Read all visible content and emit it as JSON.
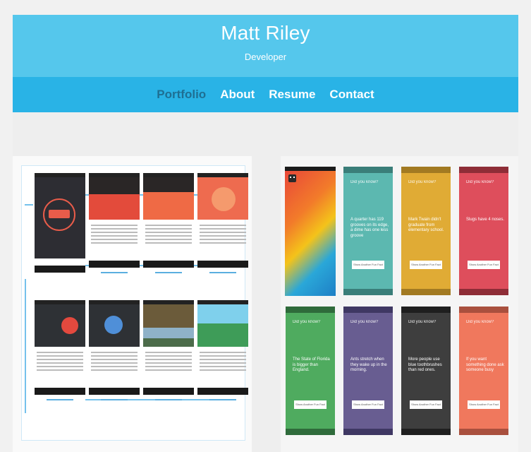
{
  "header": {
    "name": "Matt Riley",
    "role": "Developer"
  },
  "nav": {
    "items": [
      "Portfolio",
      "About",
      "Resume",
      "Contact"
    ],
    "active": "Portfolio"
  },
  "cards": {
    "question": "Did you know?",
    "button": "Show Another Fun Fact",
    "items": [
      {
        "fact": "A quarter has 119 grooves on its edge, a dime has one less groove",
        "color": "#5cb8b0",
        "dark": "#3a7e79"
      },
      {
        "fact": "Mark Twain didn't graduate from elementary school.",
        "color": "#e0ab35",
        "dark": "#a27a22"
      },
      {
        "fact": "Slugs have 4 noses.",
        "color": "#de4e5c",
        "dark": "#8e2d37"
      },
      {
        "fact": "The State of Florida is bigger than England.",
        "color": "#4fab5f",
        "dark": "#2f6b3b"
      },
      {
        "fact": "Ants stretch when they wake up in the morning.",
        "color": "#685d91",
        "dark": "#3f3863"
      },
      {
        "fact": "More people use blue toothbrushes than red ones.",
        "color": "#3e3e3e",
        "dark": "#1f1f1f"
      },
      {
        "fact": "If you want something done ask someone busy",
        "color": "#f0785d",
        "dark": "#a9503e"
      }
    ]
  }
}
